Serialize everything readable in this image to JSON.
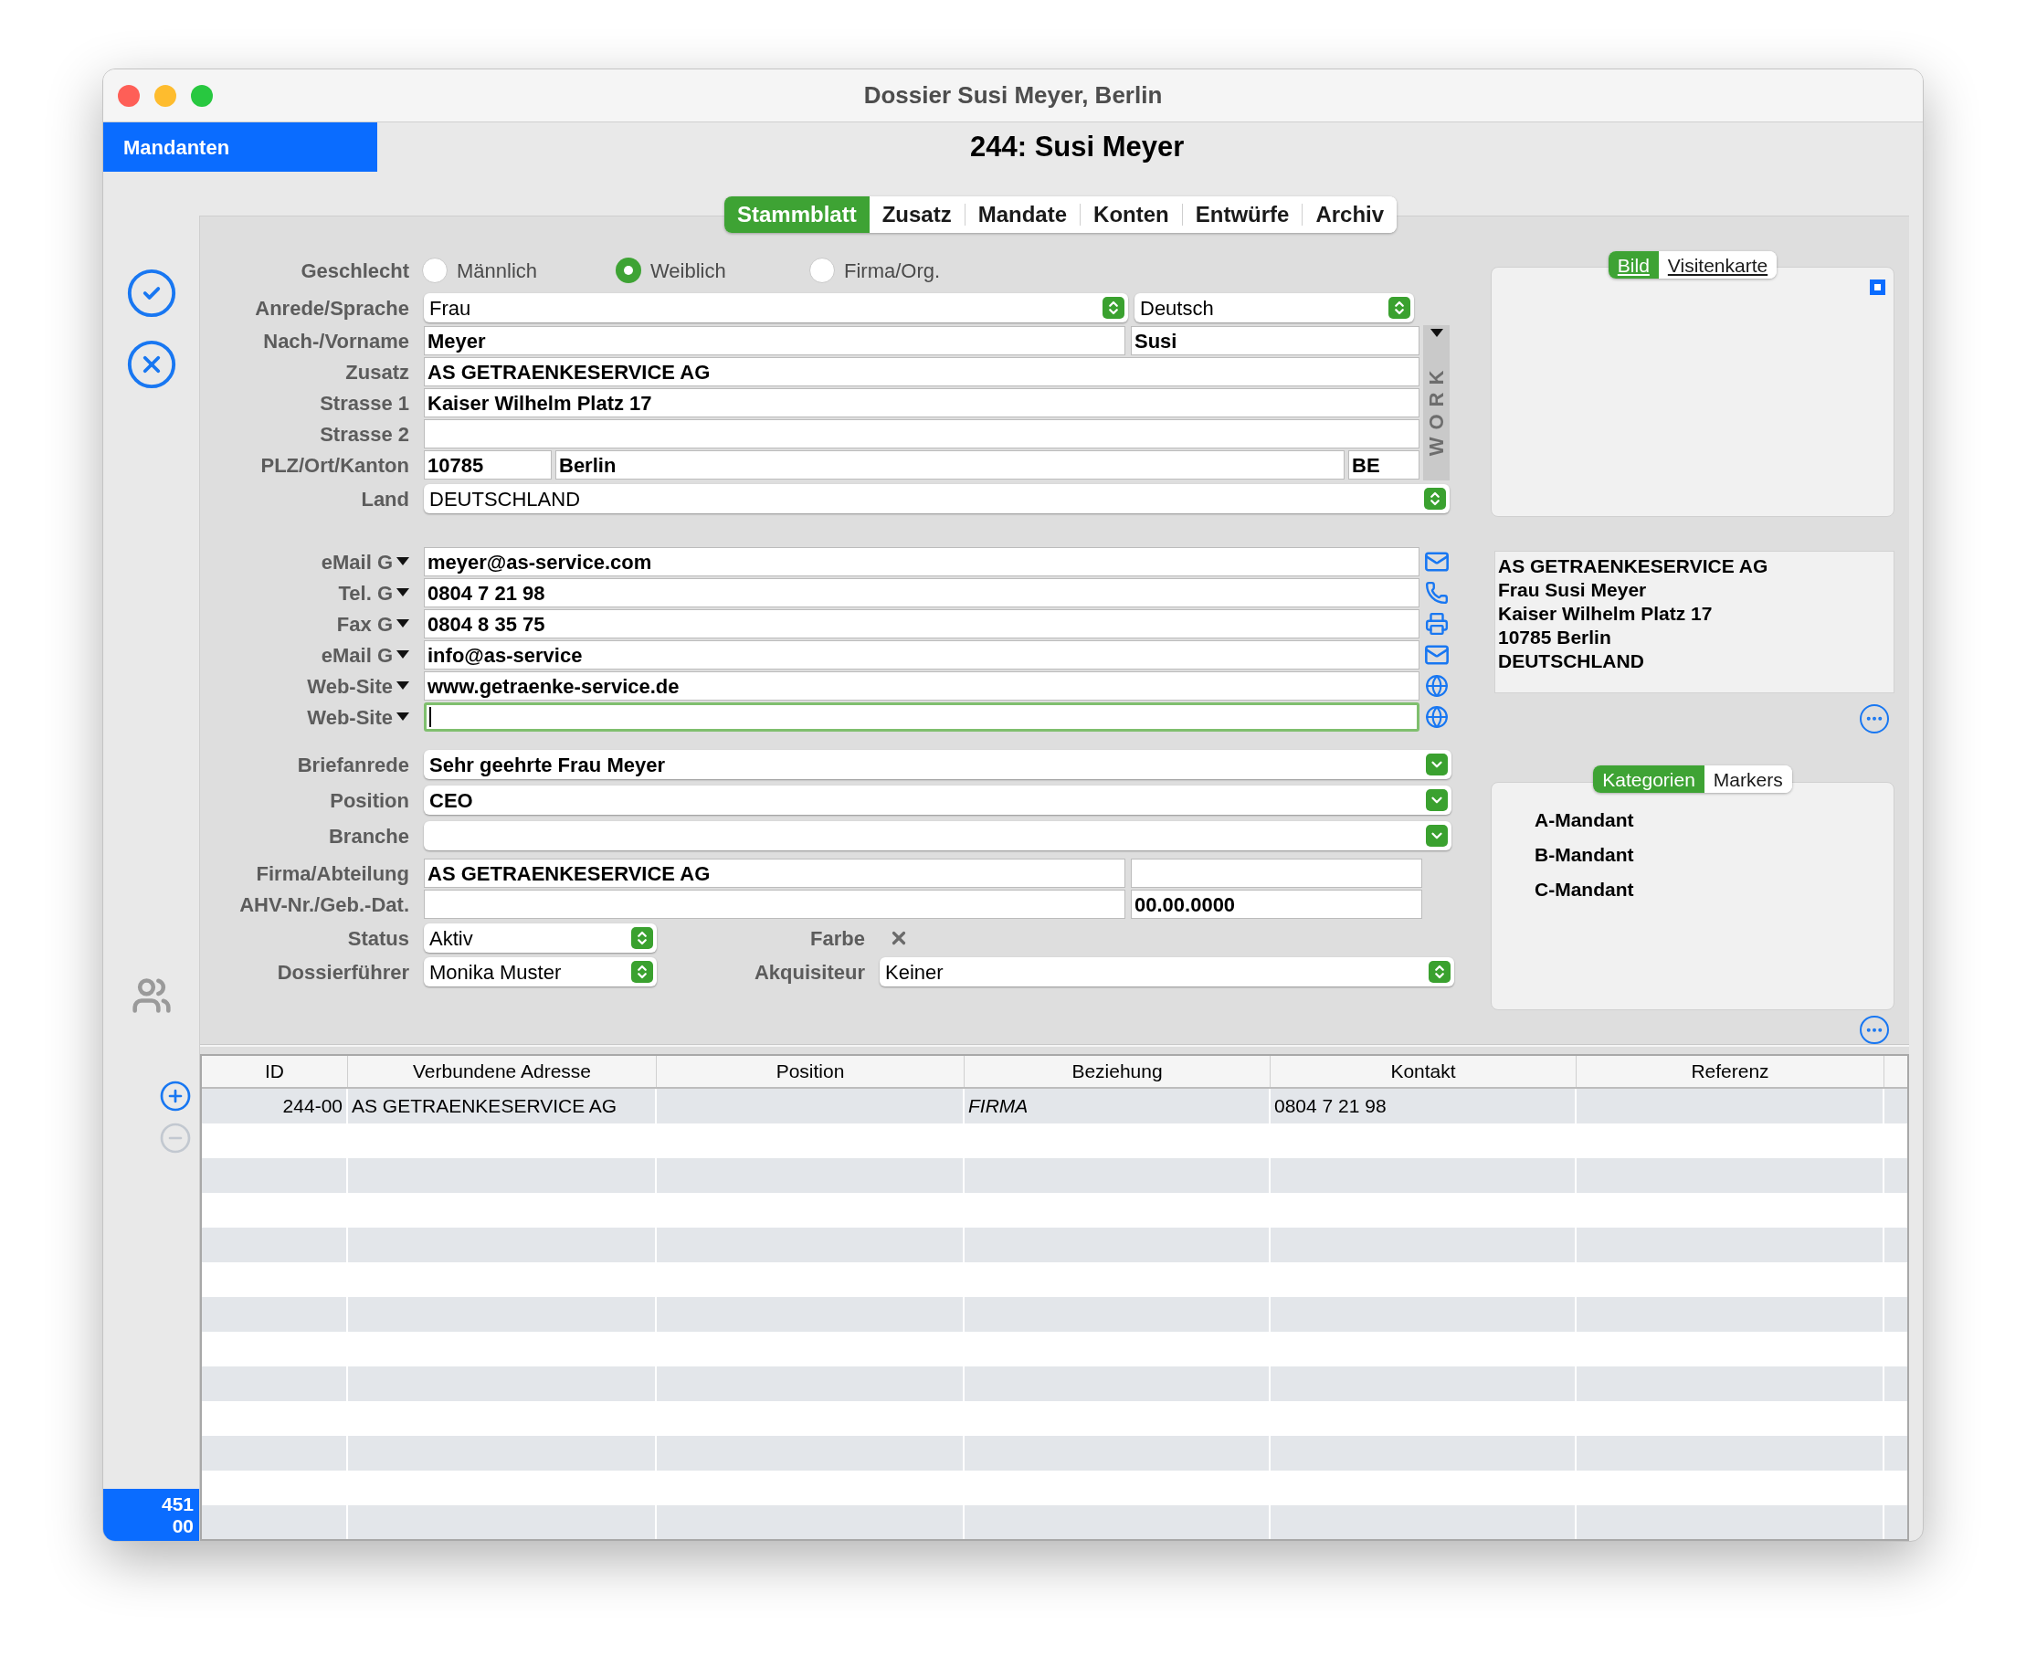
{
  "window": {
    "title": "Dossier Susi Meyer, Berlin"
  },
  "sidebar": {
    "module": "Mandanten",
    "counter": [
      "451",
      "00"
    ]
  },
  "record_title": "244: Susi Meyer",
  "tabs": [
    {
      "label": "Stammblatt",
      "selected": true
    },
    {
      "label": "Zusatz",
      "selected": false
    },
    {
      "label": "Mandate",
      "selected": false
    },
    {
      "label": "Konten",
      "selected": false
    },
    {
      "label": "Entwürfe",
      "selected": false
    },
    {
      "label": "Archiv",
      "selected": false
    }
  ],
  "gender": {
    "label": "Geschlecht",
    "options": [
      {
        "label": "Männlich",
        "selected": false
      },
      {
        "label": "Weiblich",
        "selected": true
      },
      {
        "label": "Firma/Org.",
        "selected": false
      }
    ]
  },
  "salutation": {
    "label": "Anrede/Sprache",
    "anrede": "Frau",
    "sprache": "Deutsch"
  },
  "name": {
    "label": "Nach-/Vorname",
    "last": "Meyer",
    "first": "Susi"
  },
  "zusatz": {
    "label": "Zusatz",
    "value": "AS GETRAENKESERVICE AG"
  },
  "strasse_1": {
    "label": "Strasse 1",
    "value": "Kaiser Wilhelm Platz 17"
  },
  "strasse_2": {
    "label": "Strasse 2"
  },
  "plz_ort_kanton": {
    "label": "PLZ/Ort/Kanton",
    "plz": "10785",
    "ort": "Berlin",
    "kanton": "BE"
  },
  "land": {
    "label": "Land",
    "value": "DEUTSCHLAND"
  },
  "address_tab": "WORK",
  "contacts": [
    {
      "label": "eMail G",
      "value": "meyer@as-service.com",
      "kind": "email",
      "focused": false
    },
    {
      "label": "Tel. G",
      "value": "0804 7 21 98",
      "kind": "phone",
      "focused": false
    },
    {
      "label": "Fax G",
      "value": "0804 8 35 75",
      "kind": "fax",
      "focused": false
    },
    {
      "label": "eMail G",
      "value": "info@as-service",
      "kind": "email",
      "focused": false
    },
    {
      "label": "Web-Site",
      "value": "www.getraenke-service.de",
      "kind": "web",
      "focused": false
    },
    {
      "label": "Web-Site",
      "kind": "web",
      "focused": true
    }
  ],
  "details": [
    {
      "label": "Briefanrede",
      "value": "Sehr geehrte Frau Meyer"
    },
    {
      "label": "Position",
      "value": "CEO"
    },
    {
      "label": "Branche"
    }
  ],
  "firma": {
    "label": "Firma/Abteilung",
    "value": "AS GETRAENKESERVICE AG"
  },
  "ahv": {
    "label": "AHV-Nr./Geb.-Dat.",
    "date": "00.00.0000"
  },
  "status": {
    "label": "Status",
    "value": "Aktiv"
  },
  "farbe": {
    "label": "Farbe"
  },
  "dossierfuehrer": {
    "label": "Dossierführer",
    "value": "Monika Muster"
  },
  "akquisiteur": {
    "label": "Akquisiteur",
    "value": "Keiner"
  },
  "image_panel": {
    "tabs": [
      {
        "label": "Bild",
        "selected": true
      },
      {
        "label": "Visitenkarte",
        "selected": false
      }
    ]
  },
  "address_card": {
    "lines": [
      "AS GETRAENKESERVICE AG",
      "Frau Susi Meyer",
      "Kaiser Wilhelm Platz 17",
      "10785 Berlin",
      "DEUTSCHLAND"
    ]
  },
  "category_panel": {
    "tabs": [
      {
        "label": "Kategorien",
        "selected": true
      },
      {
        "label": "Markers",
        "selected": false
      }
    ],
    "items": [
      "A-Mandant",
      "B-Mandant",
      "C-Mandant"
    ]
  },
  "table": {
    "columns": [
      "ID",
      "Verbundene Adresse",
      "Position",
      "Beziehung",
      "Kontakt",
      "Referenz"
    ],
    "rows": [
      {
        "cells": [
          "244-00",
          "AS GETRAENKESERVICE AG",
          null,
          "FIRMA",
          "0804 7 21 98",
          null
        ]
      }
    ]
  }
}
